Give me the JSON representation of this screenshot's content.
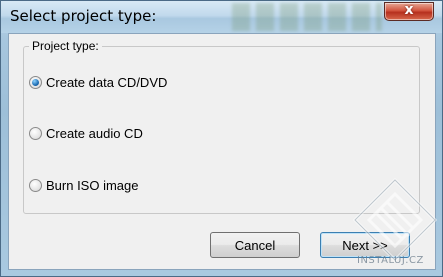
{
  "window": {
    "title": "Select project type:",
    "close_glyph": "x"
  },
  "group": {
    "label": "Project type:"
  },
  "options": [
    {
      "label": "Create data CD/DVD",
      "checked": true
    },
    {
      "label": "Create audio CD",
      "checked": false
    },
    {
      "label": "Burn ISO image",
      "checked": false
    }
  ],
  "buttons": {
    "cancel": "Cancel",
    "next": "Next >>"
  },
  "watermark": {
    "text": "INSTALUJ.CZ"
  },
  "colors": {
    "accent": "#1f6fb5",
    "close": "#c94a32"
  }
}
